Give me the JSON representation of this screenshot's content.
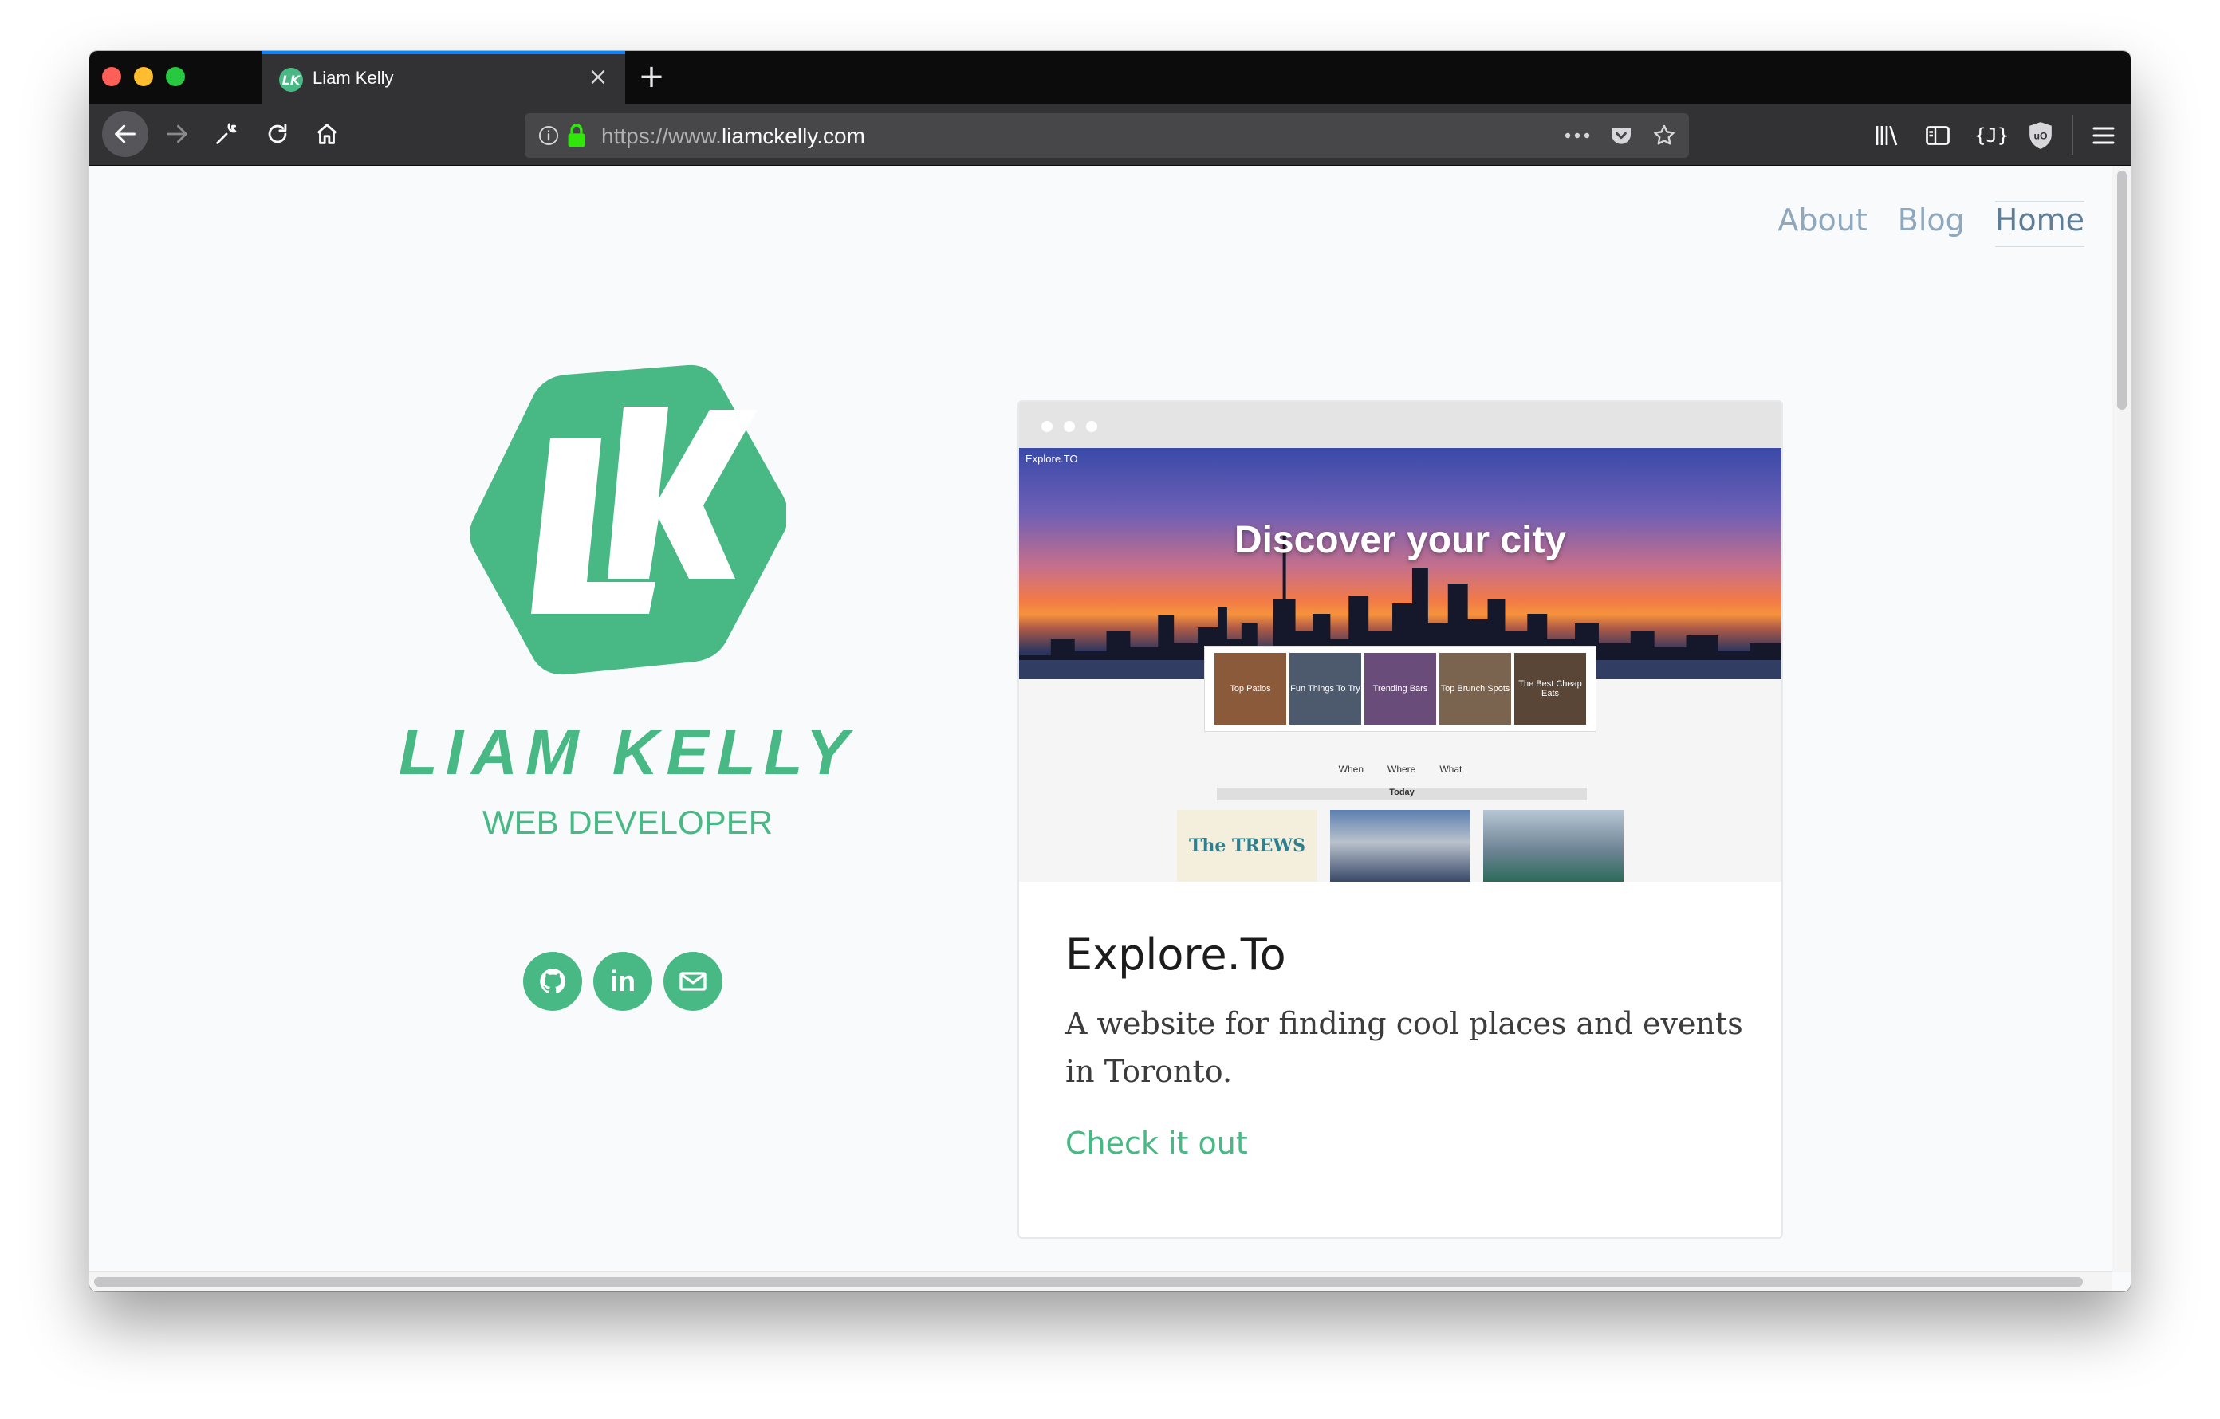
{
  "browser": {
    "tab": {
      "title": "Liam Kelly",
      "favicon": "LK"
    },
    "url": {
      "prefix": "https://www.",
      "domain": "liamckelly.com"
    },
    "colors": {
      "tab_accent": "#0a84ff",
      "chrome": "#323234"
    }
  },
  "site": {
    "nav": {
      "about": "About",
      "blog": "Blog",
      "home": "Home"
    },
    "name": "LIAM KELLY",
    "role": "WEB DEVELOPER",
    "brand_color": "#48b984",
    "socials": [
      "github-icon",
      "linkedin-icon",
      "email-icon"
    ],
    "linkedin_glyph": "in"
  },
  "project": {
    "title": "Explore.To",
    "description": "A website for finding cool places and events in Toronto.",
    "link_label": "Check it out",
    "preview": {
      "brand": "Explore.TO",
      "headline": "Discover your city",
      "categories": [
        "Top Patios",
        "Fun Things To Try",
        "Trending Bars",
        "Top Brunch Spots",
        "The Best Cheap Eats"
      ],
      "filters": [
        "When",
        "Where",
        "What"
      ],
      "today_label": "Today",
      "event_label": "The TREWS"
    }
  }
}
